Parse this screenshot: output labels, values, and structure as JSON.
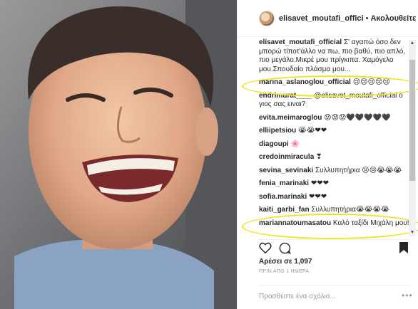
{
  "header": {
    "username": "elisavet_moutafi_offici",
    "separator": "•",
    "follow_label": "Ακολουθείτε"
  },
  "caption": {
    "username": "elisavet_moutafi_official",
    "text": "Σ' αγαπώ όσο δεν μπορώ τίποτ'άλλο να πω, πιο βαθύ, πιο απλό, πιο μεγάλο.Μικρέ μου πρίγκιπα. Χαμόγελο μου.Σπουδαίο πλάσμα μου..."
  },
  "comments": [
    {
      "username": "marina_aslanoglou_official",
      "text": "😢😢😢😢😢"
    },
    {
      "username": "endrimurat____",
      "text": "@elisavet_moutafi_official ο γιος σας ειναι?"
    },
    {
      "username": "evita.meimaroglou",
      "text": "😟😟😟🖤🖤🖤🖤🖤"
    },
    {
      "username": "elliipetsiou",
      "text": "😭😭❤❤"
    },
    {
      "username": "diagoupi",
      "text": "🌸"
    },
    {
      "username": "credoinmiracula",
      "text": "❣"
    },
    {
      "username": "sevina_sevinaki",
      "text": "Συλλυπητήρια 😢😢😭😭😭"
    },
    {
      "username": "fenia_marinaki",
      "text": "❤❤❤"
    },
    {
      "username": "sofia.marinaki",
      "text": "❤❤❤"
    },
    {
      "username": "kaiti_garbi_fan",
      "text": "Συλλυπητήρια😭😭😭😭"
    },
    {
      "username": "mariannatoumasatou",
      "text": "Καλό ταξίδι Μιχάλη μου!"
    }
  ],
  "actions": {
    "like_icon": "heart-icon",
    "comment_icon": "comment-icon",
    "save_icon": "bookmark-icon"
  },
  "likes": "Αρέσει σε 1,097",
  "time_ago": "ΠΡΙΝ ΑΠΟ 1 ΗΜΕΡΑ",
  "add_comment_placeholder": "Προσθέστε ένα σχόλιο...",
  "more_icon": "more-options-icon",
  "more_glyph": "•••",
  "highlight_color": "#f0e61e"
}
